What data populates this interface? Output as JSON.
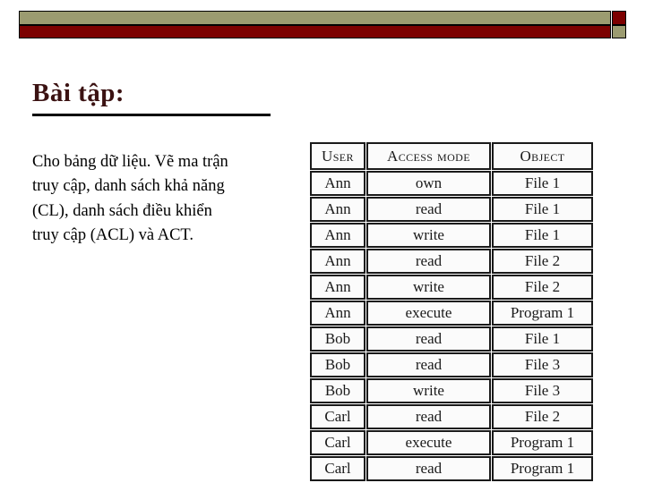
{
  "banner": {
    "colors": {
      "khaki": "#9b9b70",
      "dark_red": "#7c0000",
      "outline": "#000000"
    },
    "segments": [
      {
        "name": "top-long-bar",
        "fill": "khaki"
      },
      {
        "name": "top-end-square",
        "fill": "dark_red"
      },
      {
        "name": "bottom-long-bar",
        "fill": "dark_red"
      },
      {
        "name": "bottom-end-square",
        "fill": "khaki"
      }
    ]
  },
  "slide": {
    "title": "Bài tập:",
    "title_color": "#3b1212",
    "body": "Cho bảng dữ liệu. Vẽ ma trận truy cập, danh sách khả năng (CL), danh sách điều khiển truy cập (ACL) và ACT."
  },
  "table": {
    "headers": [
      "User",
      "Access mode",
      "Object"
    ],
    "rows": [
      {
        "user": "Ann",
        "mode": "own",
        "object": "File 1"
      },
      {
        "user": "Ann",
        "mode": "read",
        "object": "File 1"
      },
      {
        "user": "Ann",
        "mode": "write",
        "object": "File 1"
      },
      {
        "user": "Ann",
        "mode": "read",
        "object": "File 2"
      },
      {
        "user": "Ann",
        "mode": "write",
        "object": "File 2"
      },
      {
        "user": "Ann",
        "mode": "execute",
        "object": "Program 1"
      },
      {
        "user": "Bob",
        "mode": "read",
        "object": "File 1"
      },
      {
        "user": "Bob",
        "mode": "read",
        "object": "File 3"
      },
      {
        "user": "Bob",
        "mode": "write",
        "object": "File 3"
      },
      {
        "user": "Carl",
        "mode": "read",
        "object": "File 2"
      },
      {
        "user": "Carl",
        "mode": "execute",
        "object": "Program 1"
      },
      {
        "user": "Carl",
        "mode": "read",
        "object": "Program 1"
      }
    ]
  }
}
